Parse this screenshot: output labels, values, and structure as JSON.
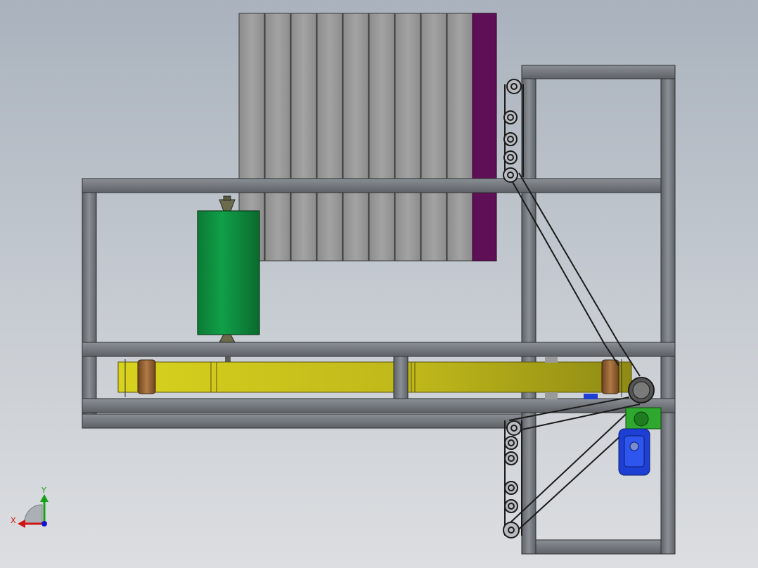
{
  "viewport": {
    "background_top": "#a9b2bd",
    "background_bottom": "#dcdee1"
  },
  "colors": {
    "frame": "#6d7177",
    "frame_light": "#8a8f95",
    "plates": "#9a9a9a",
    "plate_end": "#5e0f55",
    "roller": "#0f8f3f",
    "belt": "#c9c31a",
    "pulley": "#8a5a2e",
    "motor": "#1d3fd4",
    "gearbox": "#2fa82f",
    "chain": "#1b1b1b"
  },
  "triad": {
    "x_label": "X",
    "y_label": "Y",
    "x_color": "#d01414",
    "y_color": "#18a018",
    "z_color": "#1414d0"
  }
}
